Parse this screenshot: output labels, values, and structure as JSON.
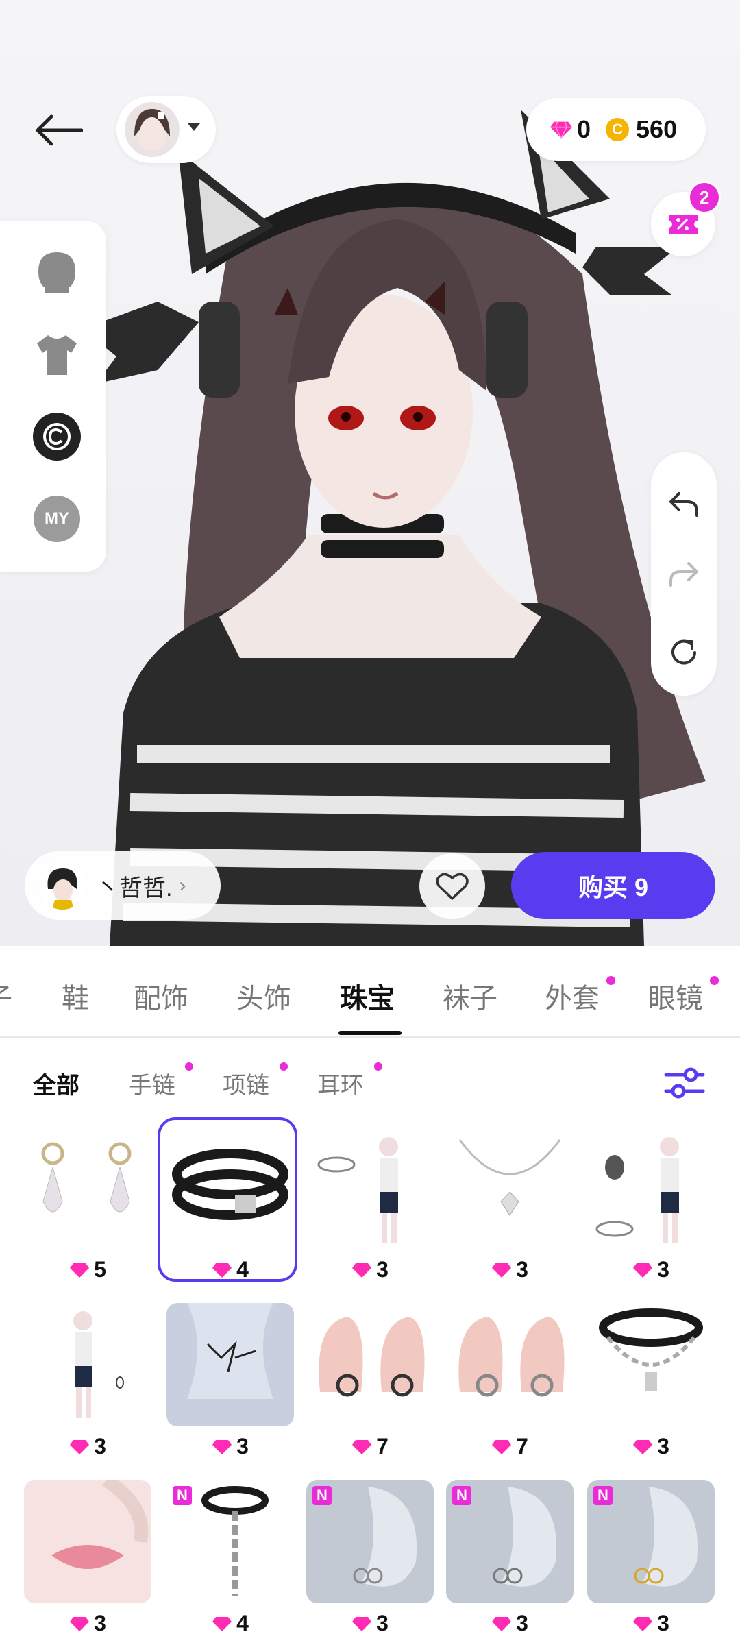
{
  "currency": {
    "diamonds": "0",
    "coins": "560",
    "coin_symbol": "C"
  },
  "coupon": {
    "count": "2"
  },
  "side_rail": {
    "my_label": "MY"
  },
  "creator": {
    "name": "丶哲哲.",
    "chevron": "›"
  },
  "buy_button": {
    "label": "购买 9"
  },
  "category_tabs": [
    "子",
    "鞋",
    "配饰",
    "头饰",
    "珠宝",
    "袜子",
    "外套",
    "眼镜"
  ],
  "active_category": "珠宝",
  "sub_tabs": [
    "全部",
    "手链",
    "项链",
    "耳环"
  ],
  "active_sub_tab": "全部",
  "items": [
    {
      "icon": "earring-icon",
      "price": "5"
    },
    {
      "icon": "choker-icon",
      "price": "4",
      "selected": true
    },
    {
      "icon": "bracelet-figure-icon",
      "price": "3"
    },
    {
      "icon": "necklace-icon",
      "price": "3"
    },
    {
      "icon": "bracelet-figure-icon",
      "price": "3"
    },
    {
      "icon": "figure-icon",
      "price": "3"
    },
    {
      "icon": "neck-tattoo-icon",
      "price": "3"
    },
    {
      "icon": "ear-piercing-icon",
      "price": "7"
    },
    {
      "icon": "ear-piercing-icon",
      "price": "7"
    },
    {
      "icon": "chain-choker-icon",
      "price": "3"
    },
    {
      "icon": "lip-piercing-icon",
      "price": "3"
    },
    {
      "icon": "choker-chain-icon",
      "price": "4",
      "badge": "N"
    },
    {
      "icon": "ear-hoops-icon",
      "price": "3",
      "badge": "N"
    },
    {
      "icon": "ear-hoops-icon",
      "price": "3",
      "badge": "N"
    },
    {
      "icon": "ear-hoops-gold-icon",
      "price": "3",
      "badge": "N"
    }
  ],
  "colors": {
    "accent": "#5a3cf0",
    "dot": "#e92bd8",
    "gem": "#ff2bb5",
    "coin": "#f5b400"
  }
}
